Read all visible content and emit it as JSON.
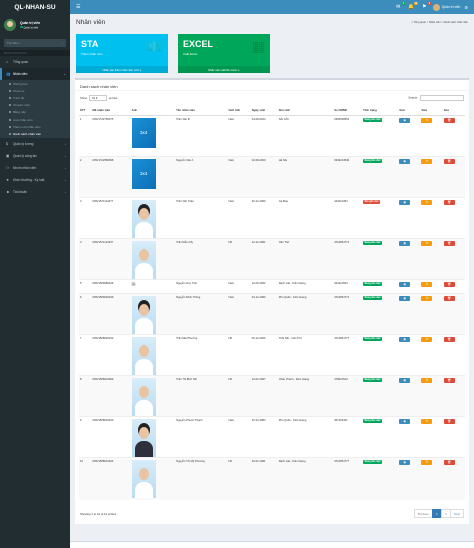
{
  "app": {
    "logo": "QL-NHAN-SU"
  },
  "navbar": {
    "toggle_icon": "hamburger-icon",
    "badges": [
      {
        "icon": "envelope-icon",
        "count": "4"
      },
      {
        "icon": "bell-icon",
        "count": "10"
      },
      {
        "icon": "flag-icon",
        "count": "9"
      }
    ],
    "user": "Quản trị viên"
  },
  "sidebar": {
    "user_name": "Quản trị viên",
    "user_status": "Quản trị viên",
    "search_placeholder": "Tìm kiếm...",
    "header": "MAIN NAVIGATION",
    "items": [
      {
        "label": "Tổng quan",
        "icon": "home-icon"
      },
      {
        "label": "Nhân viên",
        "icon": "users-icon"
      },
      {
        "label": "Quản lý lương",
        "icon": "money-icon"
      },
      {
        "label": "Quản lý công tác",
        "icon": "briefcase-icon"
      },
      {
        "label": "Nhóm nhân viên",
        "icon": "group-icon"
      },
      {
        "label": "Khen thưởng - Kỷ luật",
        "icon": "star-icon"
      },
      {
        "label": "Tài khoản",
        "icon": "user-icon"
      }
    ],
    "subitems": [
      "Phòng ban",
      "Chức vụ",
      "Trình độ",
      "Chuyên môn",
      "Bằng cấp",
      "Loại nhân viên",
      "Thêm mới nhân viên",
      "Danh sách nhân viên"
    ]
  },
  "page": {
    "title": "Nhân viên",
    "breadcrumb": [
      "Tổng quan",
      "Nhân viên",
      "Danh sách nhân viên"
    ]
  },
  "boxes": [
    {
      "title": "STA",
      "text": "Thêm nhân viên",
      "footer": "Nhấn vào thêm nhân viên mới ➜",
      "icon": "money-icon"
    },
    {
      "title": "EXCEL",
      "text": "Xuất Excel",
      "footer": "Nhấn vào xuất file excel ➜",
      "icon": "excel-icon"
    }
  ],
  "list": {
    "title": "Danh sách nhân viên",
    "show_label": "Show",
    "show_value": "10",
    "entries_label": "entries",
    "search_label": "Search:",
    "columns": [
      "STT",
      "Mã nhân viên",
      "Ảnh",
      "Tên nhân viên",
      "Giới tính",
      "Ngày sinh",
      "Nơi sinh",
      "Số CMND",
      "Tình trạng",
      "Xem",
      "Sửa",
      "Xóa"
    ],
    "rows": [
      {
        "stt": "1",
        "ma": "MNV1722750075",
        "photo": "3x4",
        "ten": "Trần Văn B",
        "gt": "Nam",
        "ns": "04-08-2024",
        "noi": "SÀI GÒI",
        "cmnd": "0365548554",
        "tt": "Đang làm việc",
        "st": "g"
      },
      {
        "stt": "2",
        "ma": "MNV1722580998",
        "photo": "3x4",
        "ten": "Nguyễn Văn A",
        "gt": "Nam",
        "ns": "02-08-2000",
        "noi": "Hà Nội",
        "cmnd": "0339214546",
        "tt": "Đang làm việc",
        "st": "g"
      },
      {
        "stt": "3",
        "ma": "MNV1571124277",
        "photo": "port",
        "ten": "Trần Văn Triệu",
        "gt": "Nam",
        "ns": "20-12-1990",
        "noi": "Cà Mau",
        "cmnd": "443212354",
        "tt": "Đã nghỉ việc",
        "st": "r"
      },
      {
        "stt": "4",
        "ma": "MNV1571124337",
        "photo": "port",
        "ten": "Trần Diễm My",
        "gt": "Nữ",
        "ns": "12-12-1991",
        "noi": "Cần Thơ",
        "cmnd": "3716654774",
        "tt": "Đang làm việc",
        "st": "g"
      },
      {
        "stt": "5",
        "ma": "MNV1569089126",
        "photo": "broken",
        "ten": "Nguyễn Duy Tình",
        "gt": "Nam",
        "ns": "12-09-1992",
        "noi": "Rạch Giá - Kiên Giang",
        "cmnd": "343214564",
        "tt": "Đang làm việc",
        "st": "g"
      },
      {
        "stt": "6",
        "ma": "MNV1569092049",
        "photo": "port",
        "ten": "Nguyễn Minh Thông",
        "gt": "Nam",
        "ns": "04-12-1990",
        "noi": "Phú Quốc - Kiên Giang",
        "cmnd": "3716654774",
        "tt": "Đang làm việc",
        "st": "g"
      },
      {
        "stt": "7",
        "ma": "MNV1568635232",
        "photo": "port",
        "ten": "Trần Mai Phương",
        "gt": "Nữ",
        "ns": "06-12-2000",
        "noi": "Thốt Nốt - Cần Thơ",
        "cmnd": "3716654777",
        "tt": "Đang làm việc",
        "st": "g"
      },
      {
        "stt": "8",
        "ma": "MNV1568634999",
        "photo": "port",
        "ten": "Trần Thị Bích Nhi",
        "gt": "Nữ",
        "ns": "12-02-1997",
        "noi": "Châu Thành - Kiên Giang",
        "cmnd": "378621543",
        "tt": "Đang làm việc",
        "st": "g"
      },
      {
        "stt": "9",
        "ma": "MNV1568633913",
        "photo": "port",
        "ten": "Nguyễn Phước Thạnh",
        "gt": "Nam",
        "ns": "15-10-1984",
        "noi": "Phú Quốc - Kiên Giang",
        "cmnd": "367423431",
        "tt": "Đang làm việc",
        "st": "g"
      },
      {
        "stt": "10",
        "ma": "MNV1568631624",
        "photo": "port",
        "ten": "Nguyễn Thị Mỹ Phương",
        "gt": "Nữ",
        "ns": "20-02-1991",
        "noi": "Rạch Giá - Kiên Giang",
        "cmnd": "3716654777",
        "tt": "Đang làm việc",
        "st": "g"
      }
    ],
    "footer_info": "Showing 1 to 10 of 12 entries",
    "pagination": {
      "prev": "Previous",
      "pages": [
        "1",
        "2"
      ],
      "next": "Next"
    }
  },
  "colors": {
    "primary": "#3c8dbc",
    "sidebar": "#222d32",
    "aqua": "#00c0ef",
    "green": "#00a65a",
    "orange": "#f39c12",
    "red": "#dd4b39"
  }
}
